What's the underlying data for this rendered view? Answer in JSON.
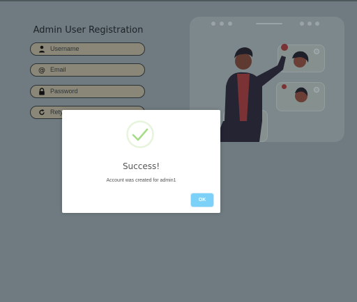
{
  "form": {
    "title": "Admin User Registration",
    "fields": [
      {
        "placeholder": "Username",
        "icon": "user-icon"
      },
      {
        "placeholder": "Email",
        "icon": "at-icon"
      },
      {
        "placeholder": "Password",
        "icon": "lock-icon"
      },
      {
        "placeholder": "Rety",
        "icon": "refresh-icon"
      }
    ]
  },
  "modal": {
    "title": "Success!",
    "message": "Account was created for admin1",
    "ok_label": "OK",
    "icon": "success-check-icon"
  },
  "colors": {
    "overlay_background": "#6f7b80",
    "ok_button": "#7cd1f9",
    "success_check": "#a5dc86",
    "modal_text": "#545454"
  }
}
